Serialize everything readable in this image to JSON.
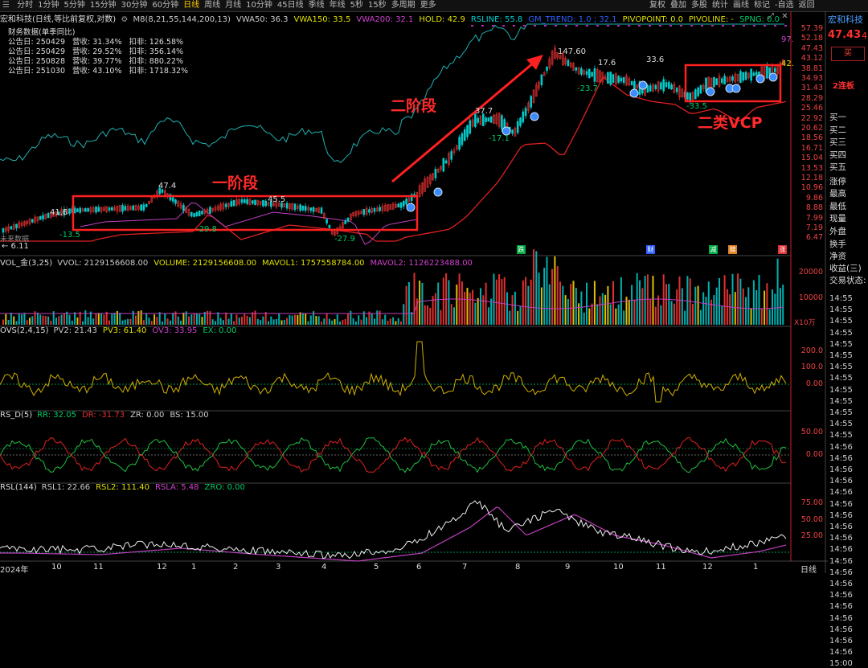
{
  "toolbar": {
    "periods": [
      "分时",
      "1分钟",
      "5分钟",
      "15分钟",
      "30分钟",
      "60分钟",
      "日线",
      "周线",
      "月线",
      "10分钟",
      "45日线",
      "季线",
      "年线",
      "5秒",
      "15秒",
      "多周期",
      "更多"
    ],
    "selected": "日线",
    "right_items": [
      "复权",
      "叠加",
      "多股",
      "统计",
      "画线",
      "标记",
      "-自选",
      "返回"
    ]
  },
  "header": {
    "title": "宏和科技(日线,等比前复权,对数)",
    "indicators": [
      {
        "text": "M8(8,21,55,144,200,13)",
        "color": "#cccccc"
      },
      {
        "text": "VWA50: 36.3",
        "color": "#cccccc"
      },
      {
        "text": "VWA150: 33.5",
        "color": "#e0e000"
      },
      {
        "text": "VWA200: 32.1",
        "color": "#d040d0"
      },
      {
        "text": "HOLD: 42.9",
        "color": "#e0e000"
      },
      {
        "text": "RSLINE: 55.8",
        "color": "#00cccc"
      },
      {
        "text": "GM_TREND: 1.0 ; 32.1",
        "color": "#3060ff"
      },
      {
        "text": "PIVOPOINT: 0.0",
        "color": "#e0e000"
      },
      {
        "text": "PIVOLINE: -",
        "color": "#e0e000"
      },
      {
        "text": "SPNG: 0.0",
        "color": "#00cc66"
      }
    ]
  },
  "finance": {
    "title": "财务数据(单季同比)",
    "rows": [
      "公告日: 250429   营收: 31.34%   扣非: 126.58%",
      "公告日: 250429   营收: 29.52%   扣非: 356.14%",
      "公告日: 250828   营收: 39.77%   扣非: 880.22%",
      "公告日: 251030   营收: 43.10%   扣非: 1718.32%"
    ],
    "future_label": "未来数据"
  },
  "annotations": {
    "stage1": "一阶段",
    "stage2": "二阶段",
    "vcp": "二类VCP"
  },
  "price_labels": [
    {
      "text": "41.6",
      "color": "#dddddd"
    },
    {
      "text": "-13.5",
      "color": "#00cc66"
    },
    {
      "text": "47.4",
      "color": "#dddddd"
    },
    {
      "text": "-29.8",
      "color": "#00cc66"
    },
    {
      "text": "45.5",
      "color": "#dddddd"
    },
    {
      "text": "-27.9",
      "color": "#00cc66"
    },
    {
      "text": "37.7",
      "color": "#dddddd"
    },
    {
      "text": "-17.1",
      "color": "#00cc66"
    },
    {
      "text": "147.60",
      "color": "#dddddd"
    },
    {
      "text": "17.6",
      "color": "#dddddd"
    },
    {
      "text": "-23.7",
      "color": "#00cc66"
    },
    {
      "text": "33.6",
      "color": "#dddddd"
    },
    {
      "text": "-33.5",
      "color": "#00cc66"
    },
    {
      "text": "97.",
      "color": "#cc44cc"
    },
    {
      "text": "42.",
      "color": "#e0e000"
    },
    {
      "text": "← 6.11",
      "color": "#dddddd"
    }
  ],
  "event_badges": [
    {
      "text": "跌",
      "color": "#00aa44"
    },
    {
      "text": "财",
      "color": "#3060ff"
    },
    {
      "text": "减",
      "color": "#00aa44"
    },
    {
      "text": "赎",
      "color": "#e08020"
    },
    {
      "text": "涨",
      "color": "#e03030"
    }
  ],
  "price_axis": [
    "57.39",
    "52.18",
    "47.43",
    "43.12",
    "38.81",
    "34.93",
    "31.43",
    "28.29",
    "25.46",
    "22.92",
    "20.62",
    "18.56",
    "16.71",
    "15.04",
    "13.53",
    "12.18",
    "10.96",
    "9.86",
    "8.88",
    "7.99",
    "7.19",
    "6.47"
  ],
  "panels": {
    "vol": {
      "title": "VOL_金(3,25)",
      "items": [
        {
          "text": "VVOL: 2129156608.00",
          "color": "#cccccc"
        },
        {
          "text": "VOLUME: 2129156608.00",
          "color": "#e0e000"
        },
        {
          "text": "MAVOL1: 1757558784.00",
          "color": "#e0e000"
        },
        {
          "text": "MAVOL2: 1126223488.00",
          "color": "#d040d0"
        }
      ],
      "ticks": [
        "20000",
        "10000"
      ],
      "unit": "X10万"
    },
    "ovs": {
      "title": "OVS(2,4,15)",
      "items": [
        {
          "text": "PV2: 21.43",
          "color": "#cccccc"
        },
        {
          "text": "PV3: 61.40",
          "color": "#e0e000"
        },
        {
          "text": "OV3: 33.95",
          "color": "#d040d0"
        },
        {
          "text": "EX: 0.00",
          "color": "#00cc66"
        }
      ],
      "ticks": [
        "200.0",
        "100.0",
        "0.00"
      ]
    },
    "rsd": {
      "title": "RS_D(5)",
      "items": [
        {
          "text": "RR: 32.05",
          "color": "#00cc66"
        },
        {
          "text": "DR: -31.73",
          "color": "#e03030"
        },
        {
          "text": "ZR: 0.00",
          "color": "#cccccc"
        },
        {
          "text": "BS: 15.00",
          "color": "#cccccc"
        }
      ],
      "ticks": [
        "50.00",
        "0.00"
      ]
    },
    "rsl": {
      "title": "RSL(144)",
      "items": [
        {
          "text": "RSL1: 22.66",
          "color": "#cccccc"
        },
        {
          "text": "RSL2: 111.40",
          "color": "#e0e000"
        },
        {
          "text": "RSLA: 5.48",
          "color": "#d040d0"
        },
        {
          "text": "ZRO: 0.00",
          "color": "#00cc66"
        }
      ],
      "ticks": [
        "75.00",
        "50.00",
        "25.00"
      ]
    }
  },
  "time_axis": {
    "labels": [
      "2024年",
      "10",
      "11",
      "12",
      "1",
      "2",
      "3",
      "4",
      "5",
      "6",
      "7",
      "8",
      "9",
      "10",
      "11",
      "12",
      "1"
    ],
    "right": "日线"
  },
  "right_panel": {
    "name": "宏和科技",
    "price": "47.43",
    "price_suffix": "4",
    "buy_button": "买",
    "tag": "2连板",
    "order_book": [
      "买一",
      "买二",
      "买三",
      "买四",
      "买五"
    ],
    "stats": [
      "涨停",
      "最高",
      "最低",
      "现量",
      "外盘"
    ],
    "extra": [
      "换手",
      "净资",
      "收益(三)",
      "交易状态:"
    ],
    "times": [
      "14:55",
      "14:55",
      "14:55",
      "14:55",
      "14:55",
      "14:55",
      "14:55",
      "14:55",
      "14:55",
      "14:55",
      "14:55",
      "14:55",
      "14:55",
      "14:56",
      "14:56",
      "14:56",
      "14:56",
      "14:56",
      "14:56",
      "14:56",
      "14:56",
      "14:56",
      "14:56",
      "14:56",
      "14:56",
      "14:56",
      "14:56",
      "14:56",
      "14:56",
      "14:56",
      "14:56",
      "14:56",
      "15:00"
    ]
  },
  "colors": {
    "up": "#e03030",
    "down": "#00cccc",
    "accent": "#ff2a2a",
    "yellow": "#e0e000"
  }
}
